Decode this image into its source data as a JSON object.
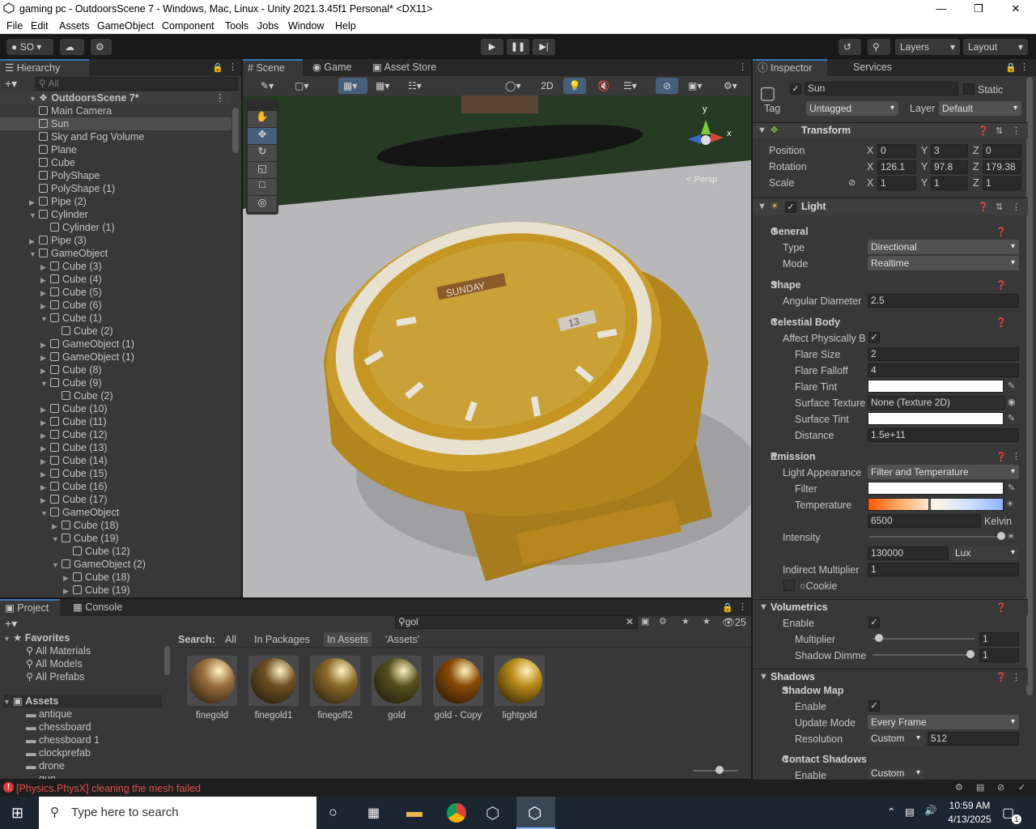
{
  "window": {
    "title": "gaming pc - OutdoorsScene 7 - Windows, Mac, Linux - Unity 2021.3.45f1 Personal* <DX11>"
  },
  "menu": [
    "File",
    "Edit",
    "Assets",
    "GameObject",
    "Component",
    "Tools",
    "Jobs",
    "Window",
    "Help"
  ],
  "toolbar": {
    "account": "SO",
    "layers": "Layers",
    "layout": "Layout"
  },
  "hierarchy": {
    "tab": "Hierarchy",
    "search_placeholder": "All",
    "scene": "OutdoorsScene 7*",
    "items": [
      {
        "label": "Main Camera",
        "depth": 1,
        "arrow": ""
      },
      {
        "label": "Sun",
        "depth": 1,
        "arrow": "",
        "selected": true
      },
      {
        "label": "Sky and Fog Volume",
        "depth": 1,
        "arrow": ""
      },
      {
        "label": "Plane",
        "depth": 1,
        "arrow": ""
      },
      {
        "label": "Cube",
        "depth": 1,
        "arrow": ""
      },
      {
        "label": "PolyShape",
        "depth": 1,
        "arrow": ""
      },
      {
        "label": "PolyShape (1)",
        "depth": 1,
        "arrow": ""
      },
      {
        "label": "Pipe (2)",
        "depth": 1,
        "arrow": "▶"
      },
      {
        "label": "Cylinder",
        "depth": 1,
        "arrow": "▼"
      },
      {
        "label": "Cylinder (1)",
        "depth": 2,
        "arrow": ""
      },
      {
        "label": "Pipe (3)",
        "depth": 1,
        "arrow": "▶"
      },
      {
        "label": "GameObject",
        "depth": 1,
        "arrow": "▼"
      },
      {
        "label": "Cube (3)",
        "depth": 2,
        "arrow": "▶"
      },
      {
        "label": "Cube (4)",
        "depth": 2,
        "arrow": "▶"
      },
      {
        "label": "Cube (5)",
        "depth": 2,
        "arrow": "▶"
      },
      {
        "label": "Cube (6)",
        "depth": 2,
        "arrow": "▶"
      },
      {
        "label": "Cube (1)",
        "depth": 2,
        "arrow": "▼"
      },
      {
        "label": "Cube (2)",
        "depth": 3,
        "arrow": ""
      },
      {
        "label": "GameObject (1)",
        "depth": 2,
        "arrow": "▶"
      },
      {
        "label": "GameObject (1)",
        "depth": 2,
        "arrow": "▶"
      },
      {
        "label": "Cube (8)",
        "depth": 2,
        "arrow": "▶"
      },
      {
        "label": "Cube (9)",
        "depth": 2,
        "arrow": "▼"
      },
      {
        "label": "Cube (2)",
        "depth": 3,
        "arrow": ""
      },
      {
        "label": "Cube (10)",
        "depth": 2,
        "arrow": "▶"
      },
      {
        "label": "Cube (11)",
        "depth": 2,
        "arrow": "▶"
      },
      {
        "label": "Cube (12)",
        "depth": 2,
        "arrow": "▶"
      },
      {
        "label": "Cube (13)",
        "depth": 2,
        "arrow": "▶"
      },
      {
        "label": "Cube (14)",
        "depth": 2,
        "arrow": "▶"
      },
      {
        "label": "Cube (15)",
        "depth": 2,
        "arrow": "▶"
      },
      {
        "label": "Cube (16)",
        "depth": 2,
        "arrow": "▶"
      },
      {
        "label": "Cube (17)",
        "depth": 2,
        "arrow": "▶"
      },
      {
        "label": "GameObject",
        "depth": 2,
        "arrow": "▼"
      },
      {
        "label": "Cube (18)",
        "depth": 3,
        "arrow": "▶"
      },
      {
        "label": "Cube (19)",
        "depth": 3,
        "arrow": "▼"
      },
      {
        "label": "Cube (12)",
        "depth": 4,
        "arrow": ""
      },
      {
        "label": "GameObject (2)",
        "depth": 3,
        "arrow": "▼"
      },
      {
        "label": "Cube (18)",
        "depth": 4,
        "arrow": "▶"
      },
      {
        "label": "Cube (19)",
        "depth": 4,
        "arrow": "▶"
      }
    ]
  },
  "scene_view": {
    "tabs": [
      "Scene",
      "Game",
      "Asset Store"
    ],
    "mode_2d": "2D",
    "persp": "< Persp",
    "gizmo_y": "y",
    "gizmo_x": "x",
    "dial_day": "SUNDAY",
    "dial_date": "13"
  },
  "inspector": {
    "tabs": [
      "Inspector",
      "Services"
    ],
    "object_name": "Sun",
    "static_label": "Static",
    "tag_label": "Tag",
    "tag_value": "Untagged",
    "layer_label": "Layer",
    "layer_value": "Default",
    "transform": {
      "title": "Transform",
      "position_label": "Position",
      "position": [
        "0",
        "3",
        "0"
      ],
      "rotation_label": "Rotation",
      "rotation": [
        "126.1",
        "97.8",
        "179.38"
      ],
      "scale_label": "Scale",
      "scale": [
        "1",
        "1",
        "1"
      ]
    },
    "light": {
      "title": "Light",
      "general": "General",
      "type_label": "Type",
      "type": "Directional",
      "mode_label": "Mode",
      "mode": "Realtime",
      "shape": "Shape",
      "angular_label": "Angular Diameter",
      "angular": "2.5",
      "celestial": "Celestial Body",
      "affect_label": "Affect Physically B",
      "flare_size_label": "Flare Size",
      "flare_size": "2",
      "flare_falloff_label": "Flare Falloff",
      "flare_falloff": "4",
      "flare_tint_label": "Flare Tint",
      "surface_texture_label": "Surface Texture",
      "surface_texture": "None (Texture 2D)",
      "surface_tint_label": "Surface Tint",
      "distance_label": "Distance",
      "distance": "1.5e+11",
      "emission": "Emission",
      "appearance_label": "Light Appearance",
      "appearance": "Filter and Temperature",
      "filter_label": "Filter",
      "temperature_label": "Temperature",
      "temperature": "6500",
      "kelvin": "Kelvin",
      "intensity_label": "Intensity",
      "intensity": "130000",
      "intensity_unit": "Lux",
      "indirect_label": "Indirect Multiplier",
      "indirect": "1",
      "cookie_label": "Cookie",
      "volumetrics": "Volumetrics",
      "vol_enable_label": "Enable",
      "multiplier_label": "Multiplier",
      "multiplier": "1",
      "shadow_dimmer_label": "Shadow Dimme",
      "shadow_dimmer": "1",
      "shadows": "Shadows",
      "shadow_map": "Shadow Map",
      "sm_enable_label": "Enable",
      "update_mode_label": "Update Mode",
      "update_mode": "Every Frame",
      "resolution_label": "Resolution",
      "resolution_mode": "Custom",
      "resolution": "512",
      "contact_shadows": "Contact Shadows",
      "cs_enable_label": "Enable",
      "cs_enable": "Custom"
    }
  },
  "project": {
    "tabs": [
      "Project",
      "Console"
    ],
    "search": "gol",
    "count": "25",
    "favorites": "Favorites",
    "fav_items": [
      "All Materials",
      "All Models",
      "All Prefabs"
    ],
    "assets": "Assets",
    "folders": [
      "antique",
      "chessboard",
      "chessboard 1",
      "clockprefab",
      "drone",
      "gun"
    ],
    "search_label": "Search:",
    "filters": [
      "All",
      "In Packages",
      "In Assets",
      "'Assets'"
    ],
    "materials": [
      {
        "name": "finegold",
        "color": "#9a6e3d"
      },
      {
        "name": "finegold1",
        "color": "#6e5025"
      },
      {
        "name": "finegolf2",
        "color": "#8a6a2a"
      },
      {
        "name": "gold",
        "color": "#55501e"
      },
      {
        "name": "gold - Copy",
        "color": "#8a4a05"
      },
      {
        "name": "lightgold",
        "color": "#b88a15"
      }
    ]
  },
  "status": {
    "message": "[Physics.PhysX] cleaning the mesh failed"
  },
  "taskbar": {
    "search_placeholder": "Type here to search",
    "time": "10:59 AM",
    "date": "4/13/2025",
    "notif": "1"
  }
}
